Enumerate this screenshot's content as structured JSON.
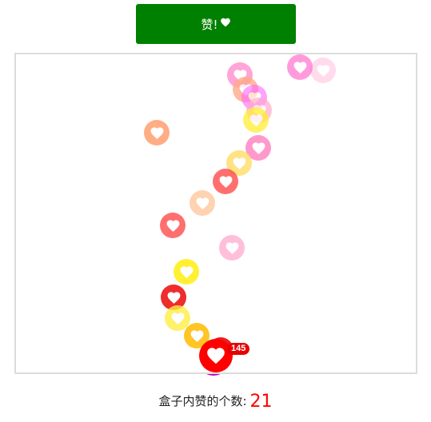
{
  "like_button": {
    "label": "赞!",
    "icon": "heart-icon",
    "color": "#008000"
  },
  "like_source": {
    "icon": "heart-icon",
    "badge": "145",
    "color": "#ff0000"
  },
  "floating_hearts": [
    {
      "color": "#ff99cc",
      "opacity": 0.35
    },
    {
      "color": "#ff66cc",
      "opacity": 0.65
    },
    {
      "color": "#ff88cc",
      "opacity": 0.75
    },
    {
      "color": "#ffaa88",
      "opacity": 0.8
    },
    {
      "color": "#ff66ff",
      "opacity": 0.6
    },
    {
      "color": "#ffaacc",
      "opacity": 0.7
    },
    {
      "color": "#ffee33",
      "opacity": 0.75
    },
    {
      "color": "#ff9966",
      "opacity": 0.8
    },
    {
      "color": "#ff77bb",
      "opacity": 0.75
    },
    {
      "color": "#ffdd66",
      "opacity": 0.8
    },
    {
      "color": "#ff3333",
      "opacity": 0.7
    },
    {
      "color": "#ffbb88",
      "opacity": 0.65
    },
    {
      "color": "#ff3333",
      "opacity": 0.7
    },
    {
      "color": "#ffaacc",
      "opacity": 0.75
    },
    {
      "color": "#ffee00",
      "opacity": 0.8
    },
    {
      "color": "#ee2222",
      "opacity": 0.95
    },
    {
      "color": "#ffee44",
      "opacity": 0.8
    },
    {
      "color": "#ffbb00",
      "opacity": 0.85
    },
    {
      "color": "#ee1111",
      "opacity": 0.95
    }
  ],
  "counter": {
    "label": "盒子内赞的个数:",
    "value": "21",
    "value_color": "#ff0000"
  }
}
